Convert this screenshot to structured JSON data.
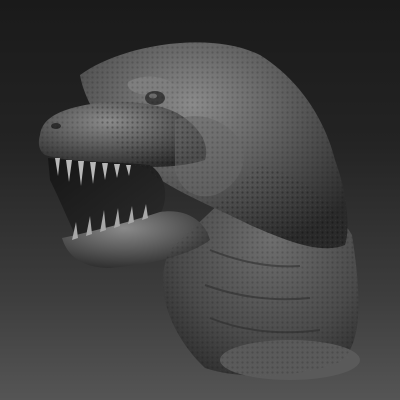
{
  "scene": {
    "subject_icon": "trex-bust-icon",
    "palette": {
      "bg_top": "#161616",
      "bg_bottom": "#555555",
      "clay_light": "#8a8a8a",
      "clay_mid": "#5e5e5e",
      "clay_dark": "#2c2c2c",
      "mouth": "#1c1c1c",
      "teeth": "#b8b8b8"
    }
  }
}
